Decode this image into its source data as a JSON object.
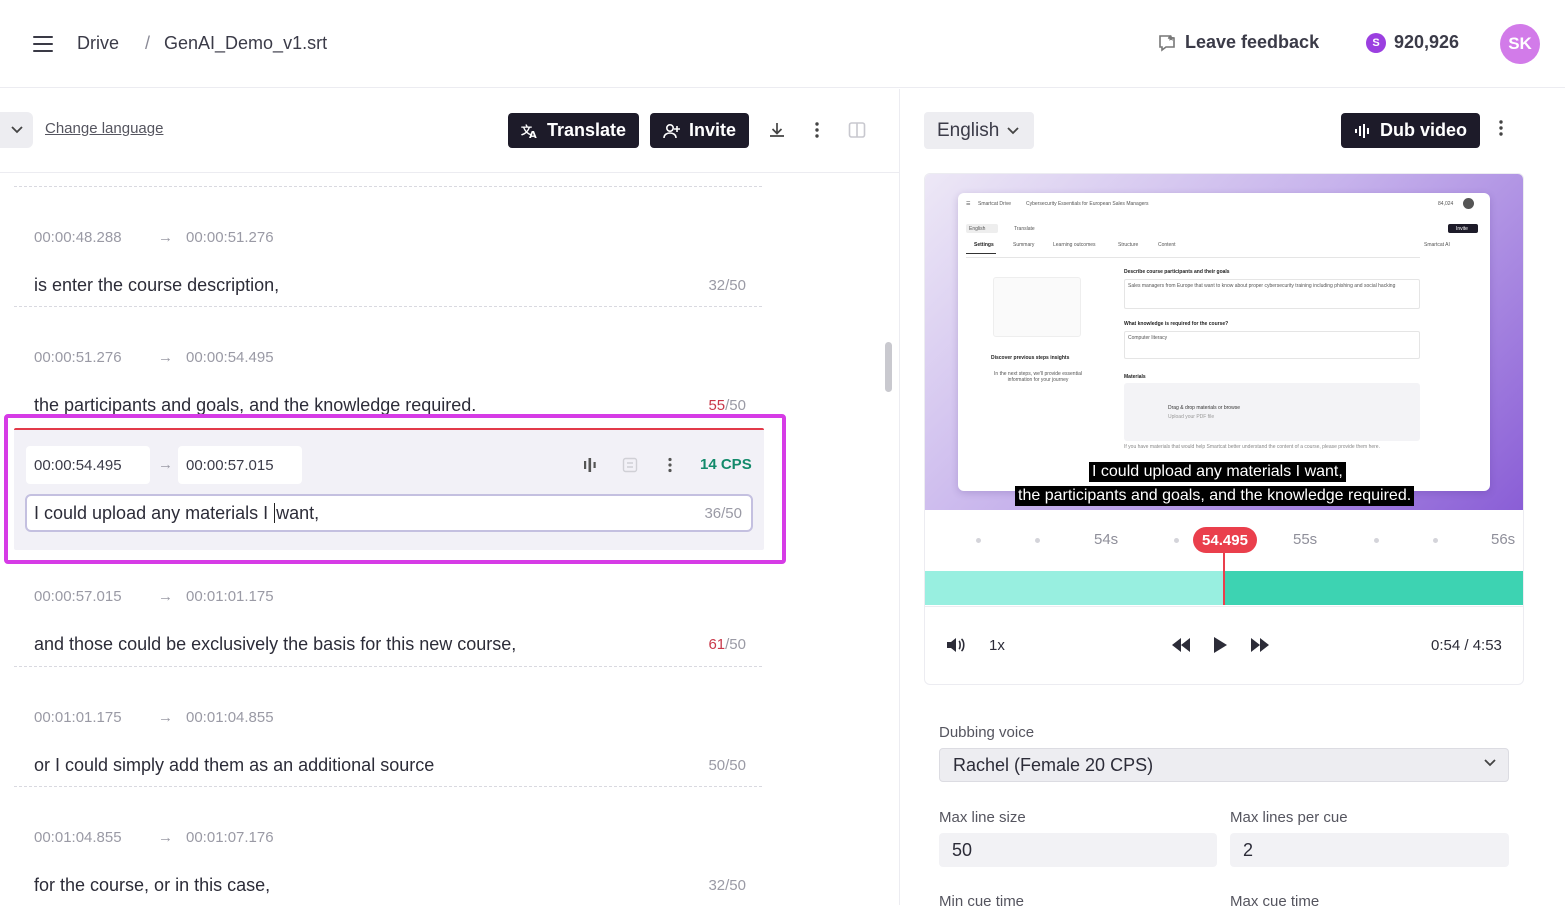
{
  "header": {
    "breadcrumb_root": "Drive",
    "breadcrumb_sep": "/",
    "file_name": "GenAI_Demo_v1.srt",
    "feedback_label": "Leave feedback",
    "credits_symbol": "S",
    "credits": "920,926",
    "avatar_initials": "SK"
  },
  "editor_toolbar": {
    "change_language": "Change language",
    "translate_label": "Translate",
    "invite_label": "Invite"
  },
  "cues": [
    {
      "start": "00:00:48.288",
      "end": "00:00:51.276",
      "text": "is enter the course description,",
      "count": "32",
      "max": "/50",
      "over": false
    },
    {
      "start": "00:00:51.276",
      "end": "00:00:54.495",
      "text": "the participants and goals, and the knowledge required.",
      "count": "55",
      "max": "/50",
      "over": true
    },
    {
      "start": "00:00:57.015",
      "end": "00:01:01.175",
      "text": "and those could be exclusively the basis for this new course,",
      "count": "61",
      "max": "/50",
      "over": true
    },
    {
      "start": "00:01:01.175",
      "end": "00:01:04.855",
      "text": "or I could simply add them as an additional source",
      "count": "50",
      "max": "/50",
      "over": false
    },
    {
      "start": "00:01:04.855",
      "end": "00:01:07.176",
      "text": "for the course, or in this case,",
      "count": "32",
      "max": "/50",
      "over": false
    }
  ],
  "active_cue": {
    "start": "00:00:54.495",
    "end": "00:00:57.015",
    "cps": "14 CPS",
    "text_before_caret": "I could upload any materials I ",
    "text_after_caret": "want,",
    "count": "36/50"
  },
  "arrow_glyph": "→",
  "right_panel": {
    "language": "English",
    "dub_label": "Dub video"
  },
  "video": {
    "mini_app": "Smartcat Drive",
    "mini_title": "Cybersecurity Essentials for European Sales Managers",
    "mini_credits": "84,024",
    "mini_lang": "English",
    "mini_translate": "Translate",
    "mini_invite": "Invite",
    "mini_tabs": [
      "Settings",
      "Summary",
      "Learning outcomes",
      "Structure",
      "Content"
    ],
    "mini_ai": "Smartcat AI",
    "mini_q1": "Describe course participants and their goals",
    "mini_a1": "Sales managers from Europe that want to know about proper cybersecurity training including phishing and social hacking",
    "mini_q2": "What knowledge is required for the course?",
    "mini_a2": "Computer literacy",
    "mini_materials": "Materials",
    "mini_drop": "Drag & drop materials or browse",
    "mini_drop_sub": "Upload your PDF file",
    "mini_discover": "Discover previous steps insights",
    "mini_discover_sub": "In the next steps, we'll provide essential information for your journey",
    "mini_footer": "If you have materials that would help Smartcat better understand the content of a course, please provide them here.",
    "subtitle_line1": "I could upload any materials I want,",
    "subtitle_line2": "the participants and goals, and the knowledge required."
  },
  "timeline": {
    "label_54": "54s",
    "label_55": "55s",
    "label_56": "56s",
    "cursor": "54.495",
    "progress": 0.5
  },
  "playback": {
    "speed": "1x",
    "time": "0:54 / 4:53"
  },
  "settings": {
    "voice_label": "Dubbing voice",
    "voice_value": "Rachel (Female 20 CPS)",
    "max_line_label": "Max line size",
    "max_line_value": "50",
    "max_lines_label": "Max lines per cue",
    "max_lines_value": "2",
    "min_cue_label": "Min cue time",
    "max_cue_label": "Max cue time"
  }
}
